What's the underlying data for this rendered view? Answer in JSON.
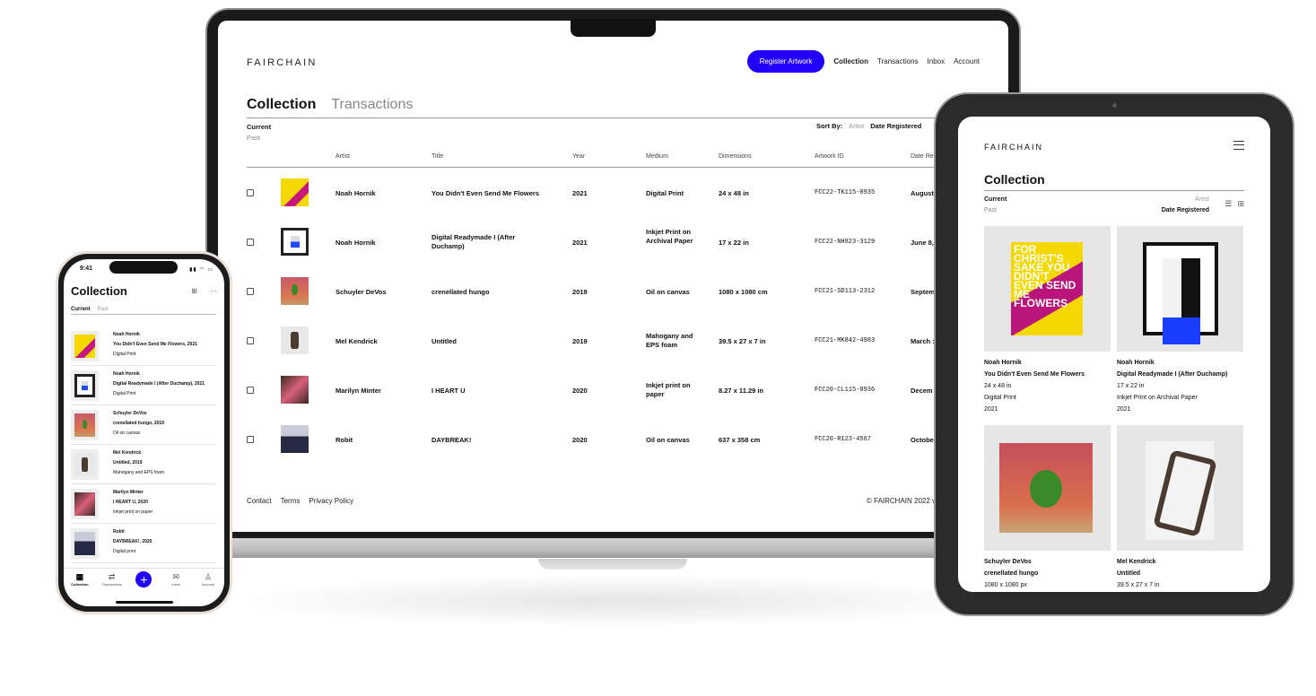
{
  "brand": "FAIRCHAIN",
  "colors": {
    "accent": "#2200ff"
  },
  "desktop": {
    "nav": {
      "register_label": "Register Artwork",
      "links": [
        "Collection",
        "Transactions",
        "Inbox",
        "Account"
      ]
    },
    "tabs": [
      "Collection",
      "Transactions"
    ],
    "filters": {
      "current": "Current",
      "past": "Past"
    },
    "sort": {
      "label": "Sort By:",
      "artist": "Artist",
      "date": "Date Registered"
    },
    "columns": [
      "Artist",
      "Title",
      "Year",
      "Medium",
      "Dimensions",
      "Artwork ID",
      "Date Reg"
    ],
    "rows": [
      {
        "artist": "Noah Hornik",
        "title": "You Didn't Even Send Me Flowers",
        "year": "2021",
        "medium": "Digital Print",
        "dims": "24 x 48 in",
        "id": "FCC22-TK115-0935",
        "date": "August",
        "thumb": "t-flowers"
      },
      {
        "artist": "Noah Hornik",
        "title": "Digital Readymade I (After Duchamp)",
        "year": "2021",
        "medium": "Inkjet Print on Archival Paper",
        "dims": "17 x 22 in",
        "id": "FCC22-NH823-3129",
        "date": "June 8,",
        "thumb": "t-duchamp"
      },
      {
        "artist": "Schuyler DeVos",
        "title": "crenellated hungo",
        "year": "2019",
        "medium": "Oil on canvas",
        "dims": "1080 x 1080 cm",
        "id": "FCC21-SD113-2312",
        "date": "Septem",
        "thumb": "t-hungo"
      },
      {
        "artist": "Mel Kendrick",
        "title": "Untitled",
        "year": "2019",
        "medium": "Mahogany and EPS foam",
        "dims": "39.5 x 27 x 7 in",
        "id": "FCC21-MK842-4983",
        "date": "March :",
        "thumb": "t-untitled"
      },
      {
        "artist": "Marilyn Minter",
        "title": "I HEART U",
        "year": "2020",
        "medium": "Inkjet print on paper",
        "dims": "8.27 x 11.29 in",
        "id": "FCC20-CL115-8936",
        "date": "Decem",
        "thumb": "t-heart"
      },
      {
        "artist": "Robit",
        "title": "DAYBREAK!",
        "year": "2020",
        "medium": "Oil on canvas",
        "dims": "637 x 358 cm",
        "id": "FCC20-R123-4567",
        "date": "Octobe",
        "thumb": "t-daybreak"
      }
    ],
    "footer": {
      "links": [
        "Contact",
        "Terms",
        "Privacy Policy"
      ],
      "copyright": "© FAIRCHAIN 2022 v"
    }
  },
  "tablet": {
    "title": "Collection",
    "filters": {
      "current": "Current",
      "past": "Past"
    },
    "sort": {
      "artist": "Artist",
      "date": "Date Registered"
    },
    "flowers_art_text": "FOR CHRIST'S SAKE YOU DIDN'T EVEN SEND ME FLOWERS",
    "cards": [
      {
        "artist": "Noah Hornik",
        "title": "You Didn't Even Send Me Flowers",
        "dims": "24 x 48 in",
        "medium": "Digital Print",
        "year": "2021"
      },
      {
        "artist": "Noah Hornik",
        "title": "Digital Readymade I (After Duchamp)",
        "dims": "17 x 22 in",
        "medium": "Inkjet Print on Archival Paper",
        "year": "2021"
      },
      {
        "artist": "Schuyler DeVos",
        "title": "crenellated hungo",
        "dims": "1080 x 1080 px"
      },
      {
        "artist": "Mel Kendrick",
        "title": "Untitled",
        "dims": "39.5 x 27 x 7 in"
      }
    ]
  },
  "phone": {
    "time": "9:41",
    "title": "Collection",
    "tabs": {
      "current": "Current",
      "past": "Past"
    },
    "items": [
      {
        "artist": "Noah Hornik",
        "title": "You Didn't Even Send Me Flowers, 2021",
        "medium": "Digital Print"
      },
      {
        "artist": "Noah Hornik",
        "title": "Digital Readymade I (After Duchamp), 2021",
        "medium": "Digital Print"
      },
      {
        "artist": "Schuyler DeVos",
        "title": "crenellated hungo, 2019",
        "medium": "Oil on canvas"
      },
      {
        "artist": "Mel Kendrick",
        "title": "Untitled, 2019",
        "medium": "Mahogany and EPS foam"
      },
      {
        "artist": "Marilyn Minter",
        "title": "I HEART U, 2020",
        "medium": "Inkjet print on paper"
      },
      {
        "artist": "Robit",
        "title": "DAYBREAK!, 2020",
        "medium": "Digital print"
      }
    ],
    "tabbar": [
      "Collection",
      "Transactions",
      "Inbox",
      "Account"
    ]
  }
}
